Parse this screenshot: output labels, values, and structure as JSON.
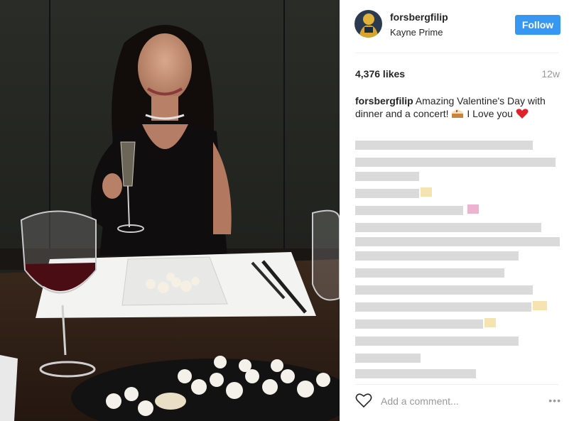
{
  "post": {
    "username": "forsbergfilip",
    "location": "Kayne Prime",
    "follow_label": "Follow",
    "likes": "4,376 likes",
    "time_ago": "12w",
    "caption_text": "Amazing Valentine's Day with dinner and a concert! ",
    "caption_text_end": "I Love you",
    "comment_placeholder": "Add a comment...",
    "more_label": "•••"
  },
  "colors": {
    "accent": "#3897f0",
    "text": "#262626",
    "muted": "#999999"
  },
  "icons": [
    "heart-icon",
    "cake-emoji",
    "red-heart-emoji",
    "more-options-icon"
  ]
}
